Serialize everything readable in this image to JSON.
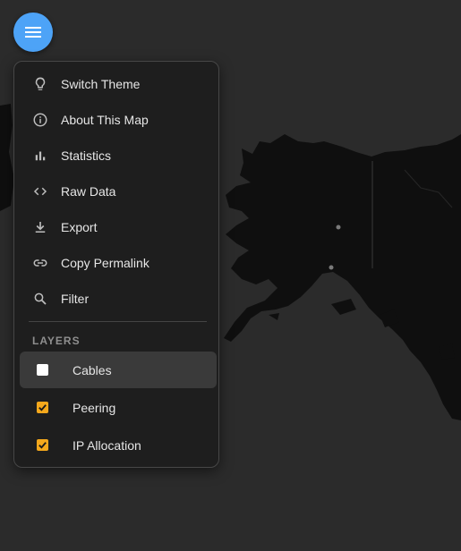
{
  "menu": {
    "toggle_icon": "hamburger-icon",
    "items": [
      {
        "label": "Switch Theme",
        "icon": "lightbulb-icon"
      },
      {
        "label": "About This Map",
        "icon": "info-icon"
      },
      {
        "label": "Statistics",
        "icon": "bar-chart-icon"
      },
      {
        "label": "Raw Data",
        "icon": "code-icon"
      },
      {
        "label": "Export",
        "icon": "download-icon"
      },
      {
        "label": "Copy Permalink",
        "icon": "link-icon"
      },
      {
        "label": "Filter",
        "icon": "search-icon"
      }
    ]
  },
  "layers": {
    "heading": "LAYERS",
    "items": [
      {
        "label": "Cables",
        "checked": false
      },
      {
        "label": "Peering",
        "checked": true
      },
      {
        "label": "IP Allocation",
        "checked": true
      }
    ]
  },
  "colors": {
    "fab": "#4da3f7",
    "checkbox_checked": "#f5a81c",
    "map_land": "#0f0f0f",
    "map_water": "#2b2b2b"
  }
}
